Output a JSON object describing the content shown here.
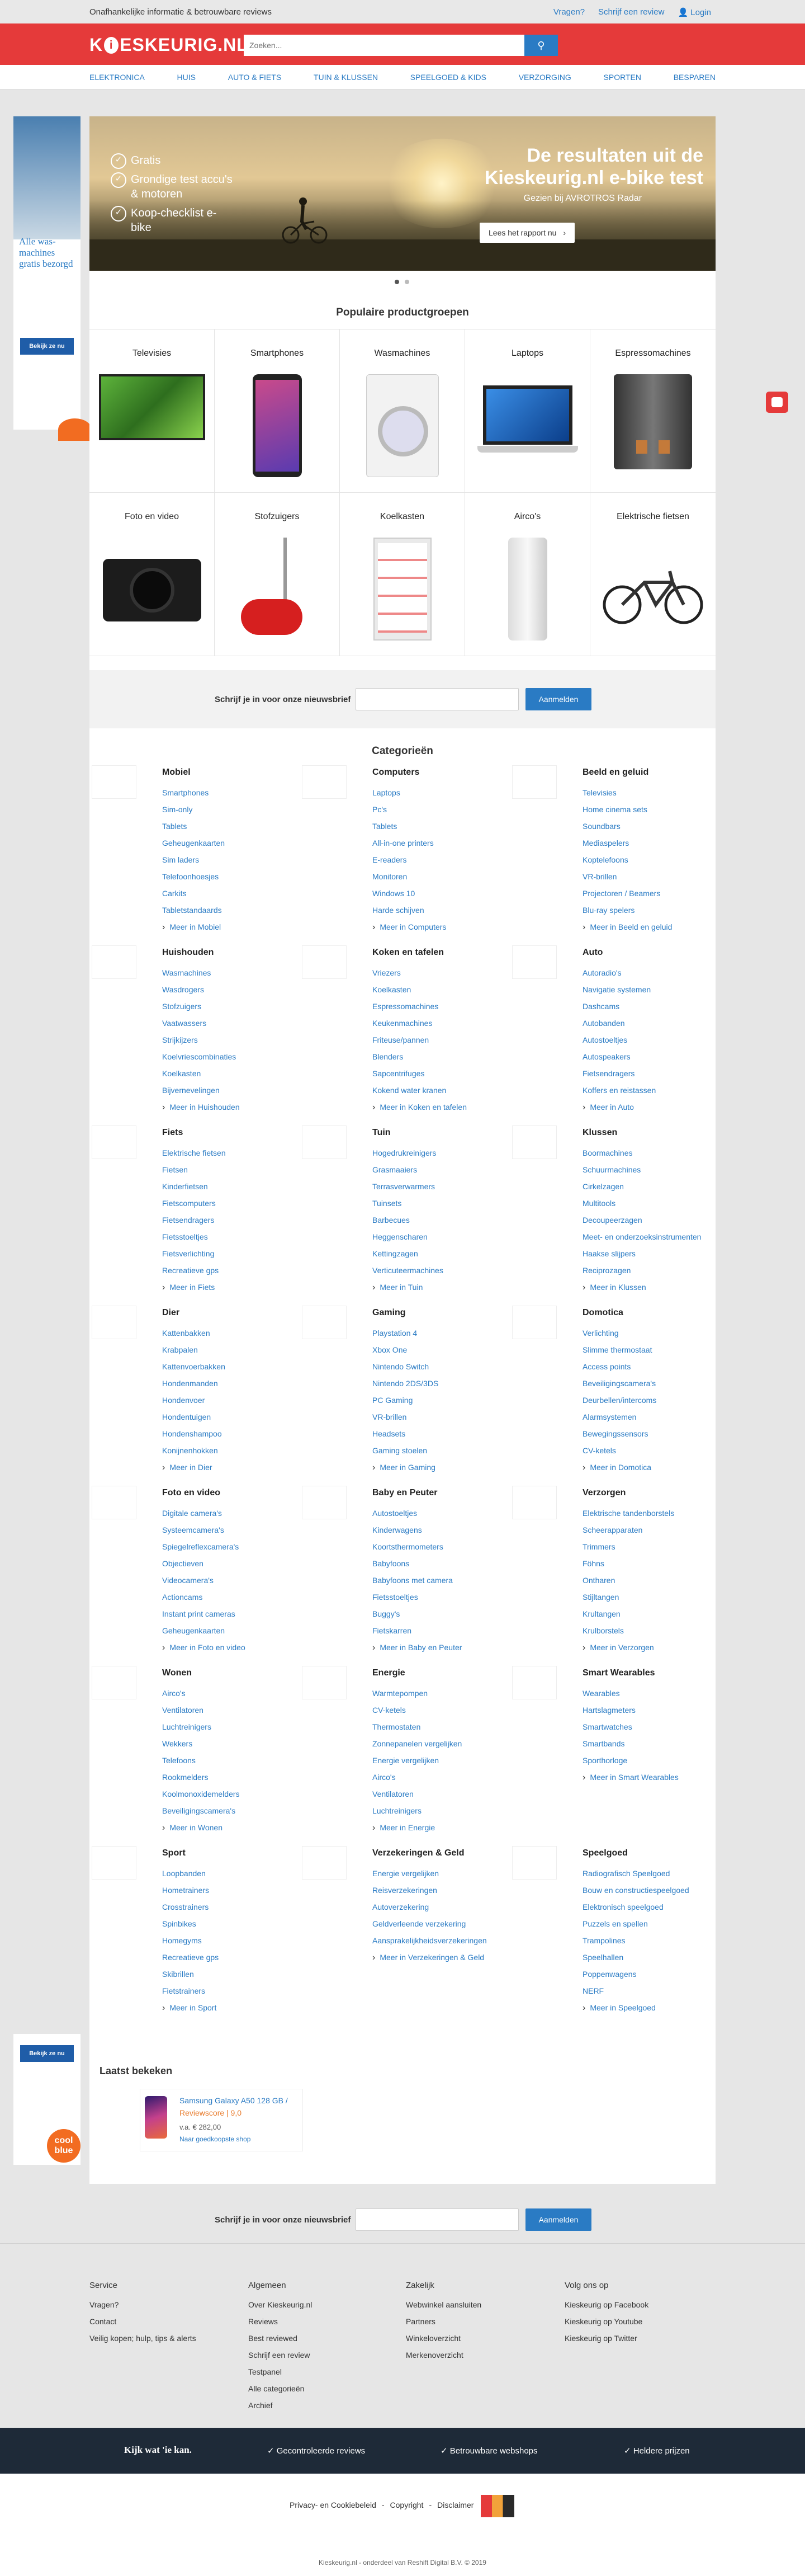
{
  "topbar": {
    "tagline": "Onafhankelijke informatie & betrouwbare reviews",
    "links": [
      "Vragen?",
      "Schrijf een review",
      "Login"
    ]
  },
  "header": {
    "logo": "KIESKEURIG.NL",
    "search_placeholder": "Zoeken..."
  },
  "nav": [
    "ELEKTRONICA",
    "HUIS",
    "AUTO & FIETS",
    "TUIN & KLUSSEN",
    "SPEELGOED & KIDS",
    "VERZORGING",
    "SPORTEN",
    "BESPAREN"
  ],
  "hero": {
    "checks": [
      "Gratis",
      "Grondige test accu's & motoren",
      "Koop-checklist e-bike"
    ],
    "title": "De resultaten uit de Kieskeurig.nl e-bike test",
    "subtitle": "Gezien bij AVROTROS Radar",
    "cta": "Lees het rapport nu"
  },
  "popular": {
    "title": "Populaire productgroepen",
    "items": [
      "Televisies",
      "Smartphones",
      "Wasmachines",
      "Laptops",
      "Espressomachines",
      "Foto en video",
      "Stofzuigers",
      "Koelkasten",
      "Airco's",
      "Elektrische fietsen"
    ]
  },
  "newsletter": {
    "text": "Schrijf je in voor onze nieuwsbrief",
    "button": "Aanmelden"
  },
  "categories": {
    "title": "Categorieën",
    "items": [
      {
        "name": "Mobiel",
        "links": [
          "Smartphones",
          "Sim-only",
          "Tablets",
          "Geheugenkaarten",
          "Sim laders",
          "Telefoonhoesjes",
          "Carkits",
          "Tabletstandaards"
        ],
        "more": "Meer in Mobiel"
      },
      {
        "name": "Computers",
        "links": [
          "Laptops",
          "Pc's",
          "Tablets",
          "All-in-one printers",
          "E-readers",
          "Monitoren",
          "Windows 10",
          "Harde schijven"
        ],
        "more": "Meer in Computers"
      },
      {
        "name": "Beeld en geluid",
        "links": [
          "Televisies",
          "Home cinema sets",
          "Soundbars",
          "Mediaspelers",
          "Koptelefoons",
          "VR-brillen",
          "Projectoren / Beamers",
          "Blu-ray spelers"
        ],
        "more": "Meer in Beeld en geluid"
      },
      {
        "name": "Huishouden",
        "links": [
          "Wasmachines",
          "Wasdrogers",
          "Stofzuigers",
          "Vaatwassers",
          "Strijkijzers",
          "Koelvriescombinaties",
          "Koelkasten",
          "Bijvernevelingen"
        ],
        "more": "Meer in Huishouden"
      },
      {
        "name": "Koken en tafelen",
        "links": [
          "Vriezers",
          "Koelkasten",
          "Espressomachines",
          "Keukenmachines",
          "Friteuse/pannen",
          "Blenders",
          "Sapcentrifuges",
          "Kokend water kranen"
        ],
        "more": "Meer in Koken en tafelen"
      },
      {
        "name": "Auto",
        "links": [
          "Autoradio's",
          "Navigatie systemen",
          "Dashcams",
          "Autobanden",
          "Autostoeltjes",
          "Autospeakers",
          "Fietsendragers",
          "Koffers en reistassen"
        ],
        "more": "Meer in Auto"
      },
      {
        "name": "Fiets",
        "links": [
          "Elektrische fietsen",
          "Fietsen",
          "Kinderfietsen",
          "Fietscomputers",
          "Fietsendragers",
          "Fietsstoeltjes",
          "Fietsverlichting",
          "Recreatieve gps"
        ],
        "more": "Meer in Fiets"
      },
      {
        "name": "Tuin",
        "links": [
          "Hogedrukreinigers",
          "Grasmaaiers",
          "Terrasverwarmers",
          "Tuinsets",
          "Barbecues",
          "Heggenscharen",
          "Kettingzagen",
          "Verticuteermachines"
        ],
        "more": "Meer in Tuin"
      },
      {
        "name": "Klussen",
        "links": [
          "Boormachines",
          "Schuurmachines",
          "Cirkelzagen",
          "Multitools",
          "Decoupeerzagen",
          "Meet- en onderzoeksinstrumenten",
          "Haakse slijpers",
          "Reciprozagen"
        ],
        "more": "Meer in Klussen"
      },
      {
        "name": "Dier",
        "links": [
          "Kattenbakken",
          "Krabpalen",
          "Kattenvoerbakken",
          "Hondenmanden",
          "Hondenvoer",
          "Hondentuigen",
          "Hondenshampoo",
          "Konijnenhokken"
        ],
        "more": "Meer in Dier"
      },
      {
        "name": "Gaming",
        "links": [
          "Playstation 4",
          "Xbox One",
          "Nintendo Switch",
          "Nintendo 2DS/3DS",
          "PC Gaming",
          "VR-brillen",
          "Headsets",
          "Gaming stoelen"
        ],
        "more": "Meer in Gaming"
      },
      {
        "name": "Domotica",
        "links": [
          "Verlichting",
          "Slimme thermostaat",
          "Access points",
          "Beveiligingscamera's",
          "Deurbellen/intercoms",
          "Alarmsystemen",
          "Bewegingssensors",
          "CV-ketels"
        ],
        "more": "Meer in Domotica"
      },
      {
        "name": "Foto en video",
        "links": [
          "Digitale camera's",
          "Systeemcamera's",
          "Spiegelreflexcamera's",
          "Objectieven",
          "Videocamera's",
          "Actioncams",
          "Instant print cameras",
          "Geheugenkaarten"
        ],
        "more": "Meer in Foto en video"
      },
      {
        "name": "Baby en Peuter",
        "links": [
          "Autostoeltjes",
          "Kinderwagens",
          "Koortsthermometers",
          "Babyfoons",
          "Babyfoons met camera",
          "Fietsstoeltjes",
          "Buggy's",
          "Fietskarren"
        ],
        "more": "Meer in Baby en Peuter"
      },
      {
        "name": "Verzorgen",
        "links": [
          "Elektrische tandenborstels",
          "Scheerapparaten",
          "Trimmers",
          "Föhns",
          "Ontharen",
          "Stijltangen",
          "Krultangen",
          "Krulborstels"
        ],
        "more": "Meer in Verzorgen"
      },
      {
        "name": "Wonen",
        "links": [
          "Airco's",
          "Ventilatoren",
          "Luchtreinigers",
          "Wekkers",
          "Telefoons",
          "Rookmelders",
          "Koolmonoxidemelders",
          "Beveiligingscamera's"
        ],
        "more": "Meer in Wonen"
      },
      {
        "name": "Energie",
        "links": [
          "Warmtepompen",
          "CV-ketels",
          "Thermostaten",
          "Zonnepanelen vergelijken",
          "Energie vergelijken",
          "Airco's",
          "Ventilatoren",
          "Luchtreinigers"
        ],
        "more": "Meer in Energie"
      },
      {
        "name": "Smart Wearables",
        "links": [
          "Wearables",
          "Hartslagmeters",
          "Smartwatches",
          "Smartbands",
          "Sporthorloge"
        ],
        "more": "Meer in Smart Wearables"
      },
      {
        "name": "Sport",
        "links": [
          "Loopbanden",
          "Hometrainers",
          "Crosstrainers",
          "Spinbikes",
          "Homegyms",
          "Recreatieve gps",
          "Skibrillen",
          "Fietstrainers"
        ],
        "more": "Meer in Sport"
      },
      {
        "name": "Verzekeringen & Geld",
        "links": [
          "Energie vergelijken",
          "Reisverzekeringen",
          "Autoverzekering",
          "Geldverleende verzekering",
          "Aansprakelijkheidsverzekeringen"
        ],
        "more": "Meer in Verzekeringen & Geld"
      },
      {
        "name": "Speelgoed",
        "links": [
          "Radiografisch Speelgoed",
          "Bouw en constructiespeelgoed",
          "Elektronisch speelgoed",
          "Puzzels en spellen",
          "Trampolines",
          "Speelhallen",
          "Poppenwagens",
          "NERF"
        ],
        "more": "Meer in Speelgoed"
      }
    ]
  },
  "recent": {
    "title": "Laatst bekeken",
    "product": "Samsung Galaxy A50 128 GB /",
    "score": "Reviewscore | 9,0",
    "price": "v.a. € 282,00",
    "shop": "Naar goedkoopste shop"
  },
  "ads": {
    "top_text": "Alle was-machines gratis bezorgd",
    "button": "Bekijk ze nu",
    "brand": "cool blue"
  },
  "footer": {
    "cols": [
      {
        "title": "Service",
        "links": [
          "Vragen?",
          "Contact",
          "Veilig kopen; hulp, tips & alerts"
        ]
      },
      {
        "title": "Algemeen",
        "links": [
          "Over Kieskeurig.nl",
          "Reviews",
          "Best reviewed",
          "Schrijf een review",
          "Testpanel",
          "Alle categorieën",
          "Archief"
        ]
      },
      {
        "title": "Zakelijk",
        "links": [
          "Webwinkel aansluiten",
          "Partners",
          "Winkeloverzicht",
          "Merkenoverzicht"
        ]
      },
      {
        "title": "Volg ons op",
        "links": [
          "Kieskeurig op Facebook",
          "Kieskeurig op Youtube",
          "Kieskeurig op Twitter"
        ]
      }
    ],
    "trust_title": "Kijk wat 'ie kan.",
    "trust": [
      "Gecontroleerde reviews",
      "Betrouwbare webshops",
      "Heldere prijzen"
    ],
    "bottom_links": [
      "Privacy- en Cookiebeleid",
      "-",
      "Copyright",
      "-",
      "Disclaimer"
    ],
    "copy": "Kieskeurig.nl - onderdeel van Reshift Digital B.V. © 2019"
  }
}
